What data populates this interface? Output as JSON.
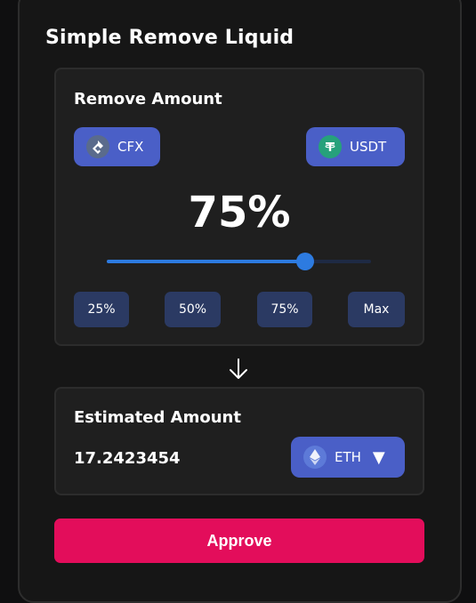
{
  "title": "Simple Remove Liquid",
  "remove": {
    "heading": "Remove Amount",
    "token_a": {
      "symbol": "CFX",
      "icon": "cfx-icon"
    },
    "token_b": {
      "symbol": "USDT",
      "icon": "usdt-icon"
    },
    "percent_label": "75%",
    "slider_value": 0.75,
    "presets": [
      "25%",
      "50%",
      "75%",
      "Max"
    ]
  },
  "estimate": {
    "heading": "Estimated Amount",
    "amount": "17.2423454",
    "token": {
      "symbol": "ETH",
      "icon": "eth-icon",
      "caret": "▼"
    }
  },
  "approve_label": "Approve",
  "colors": {
    "accent": "#e30d5b",
    "token_pill": "#4a5fc7",
    "slider": "#2d7be0",
    "preset": "#2b3a63"
  }
}
